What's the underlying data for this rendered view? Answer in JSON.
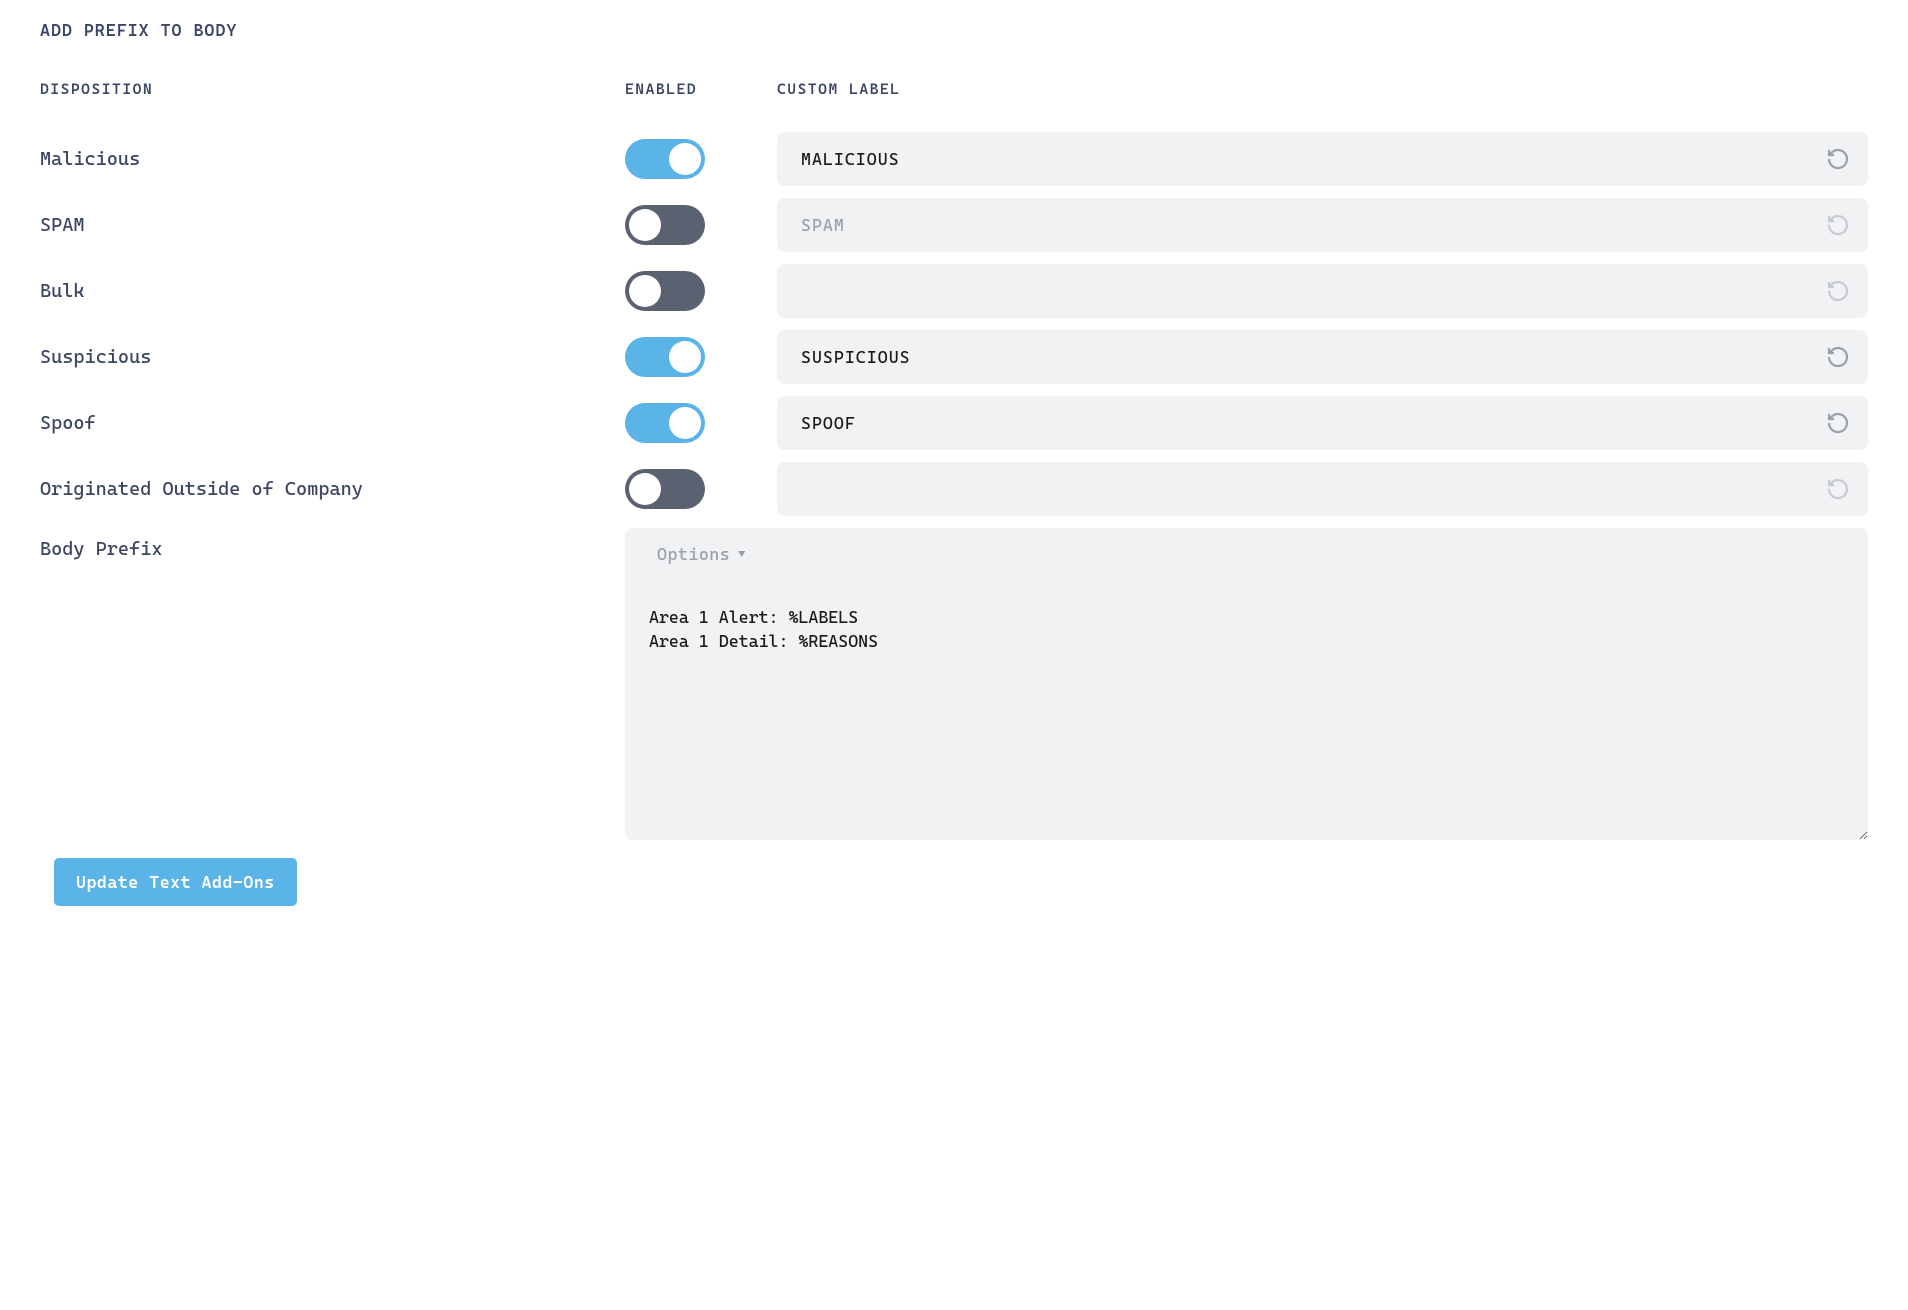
{
  "section_title": "ADD PREFIX TO BODY",
  "headers": {
    "disposition": "DISPOSITION",
    "enabled": "ENABLED",
    "custom_label": "CUSTOM LABEL"
  },
  "rows": [
    {
      "name": "Malicious",
      "enabled": true,
      "custom_label": "MALICIOUS",
      "placeholder": "",
      "input_enabled": true
    },
    {
      "name": "SPAM",
      "enabled": false,
      "custom_label": "",
      "placeholder": "SPAM",
      "input_enabled": true
    },
    {
      "name": "Bulk",
      "enabled": false,
      "custom_label": "",
      "placeholder": "",
      "input_enabled": false
    },
    {
      "name": "Suspicious",
      "enabled": true,
      "custom_label": "SUSPICIOUS",
      "placeholder": "",
      "input_enabled": true
    },
    {
      "name": "Spoof",
      "enabled": true,
      "custom_label": "SPOOF",
      "placeholder": "",
      "input_enabled": true
    },
    {
      "name": "Originated Outside of Company",
      "enabled": false,
      "custom_label": "",
      "placeholder": "",
      "input_enabled": false
    }
  ],
  "body_prefix": {
    "label": "Body Prefix",
    "options_label": "Options",
    "value": "Area 1 Alert: %LABELS\nArea 1 Detail: %REASONS"
  },
  "update_button": "Update Text Add-Ons"
}
